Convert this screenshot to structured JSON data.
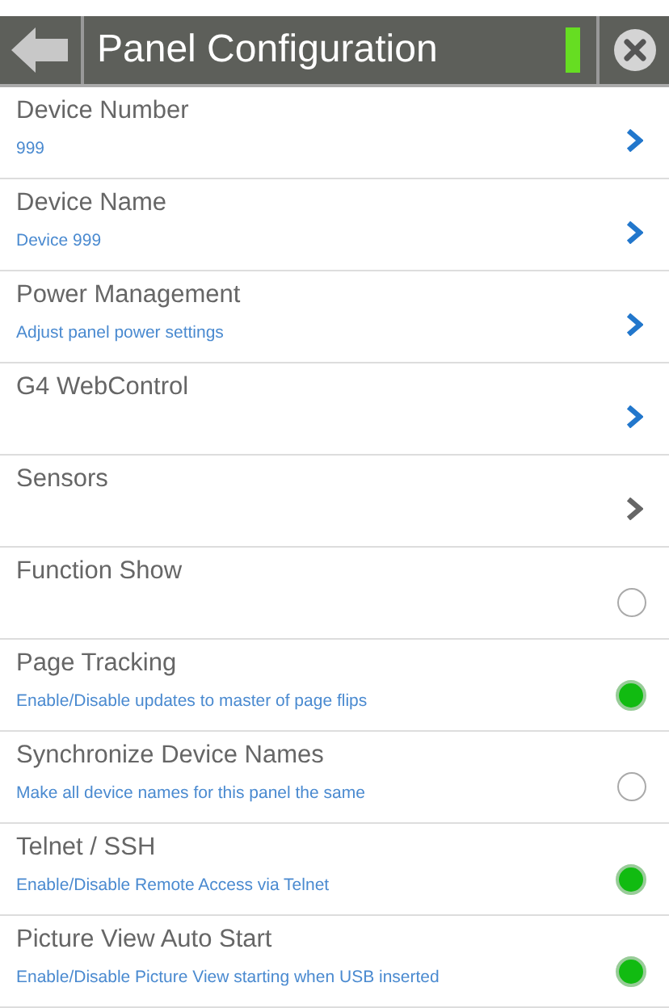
{
  "header": {
    "title": "Panel Configuration",
    "indicator_on": true
  },
  "items": [
    {
      "kind": "link",
      "label": "Device Number",
      "subtitle": "999",
      "disabled": false
    },
    {
      "kind": "link",
      "label": "Device Name",
      "subtitle": "Device 999",
      "disabled": false
    },
    {
      "kind": "link",
      "label": "Power Management",
      "subtitle": "Adjust panel power settings",
      "disabled": false
    },
    {
      "kind": "link",
      "label": "G4 WebControl",
      "disabled": false
    },
    {
      "kind": "link",
      "label": "Sensors",
      "disabled": true
    },
    {
      "kind": "toggle",
      "label": "Function Show",
      "on": false
    },
    {
      "kind": "toggle",
      "label": "Page Tracking",
      "subtitle": "Enable/Disable updates to master of page flips",
      "on": true
    },
    {
      "kind": "toggle",
      "label": "Synchronize Device Names",
      "subtitle": "Make all device names for this panel the same",
      "on": false
    },
    {
      "kind": "toggle",
      "label": "Telnet / SSH",
      "subtitle": "Enable/Disable Remote Access via Telnet",
      "on": true
    },
    {
      "kind": "toggle",
      "label": "Picture View Auto Start",
      "subtitle": "Enable/Disable Picture View starting when USB inserted",
      "on": true
    }
  ]
}
